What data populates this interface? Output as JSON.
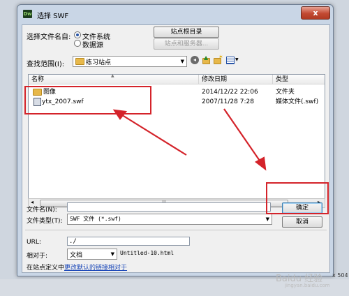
{
  "window": {
    "title": "选择 SWF",
    "app_icon": "Dw",
    "close_glyph": "x"
  },
  "select_from": {
    "label": "选择文件名自:",
    "options": [
      {
        "label": "文件系统",
        "checked": true
      },
      {
        "label": "数据源",
        "checked": false
      }
    ],
    "site_root_button": "站点根目录",
    "site_server_button": "站点和服务器..."
  },
  "lookin": {
    "label": "查找范围(I):",
    "value": "练习站点"
  },
  "columns": {
    "name": "名称",
    "modified": "修改日期",
    "type": "类型"
  },
  "files": [
    {
      "name": "图像",
      "date": "2014/12/22 22:06",
      "type": "文件夹",
      "icon": "folder-icon"
    },
    {
      "name": "ytx_2007.swf",
      "date": "2007/11/28 7:28",
      "type": "媒体文件(.swf)",
      "icon": "swf-file-icon"
    }
  ],
  "scroll": {
    "left_arrow": "◂",
    "right_arrow": "▸",
    "grip": "|||"
  },
  "filename": {
    "label": "文件名(N):",
    "value": ""
  },
  "filetype": {
    "label": "文件类型(T):",
    "value": "SWF 文件 (*.swf)"
  },
  "buttons": {
    "ok": "确定",
    "cancel": "取消"
  },
  "url": {
    "label": "URL:",
    "value": "./"
  },
  "relative": {
    "label": "相对于:",
    "value": "文档",
    "file": "Untitled-10.html"
  },
  "footer": {
    "prefix": "在站点定义中",
    "link": "更改默认的链接相对于"
  },
  "background": {
    "right_text": "x 504",
    "watermark": "Baidu 经验",
    "watermark_url": "jingyan.baidu.com"
  },
  "colors": {
    "annotation": "#d4232a",
    "link": "#1a47b8"
  }
}
